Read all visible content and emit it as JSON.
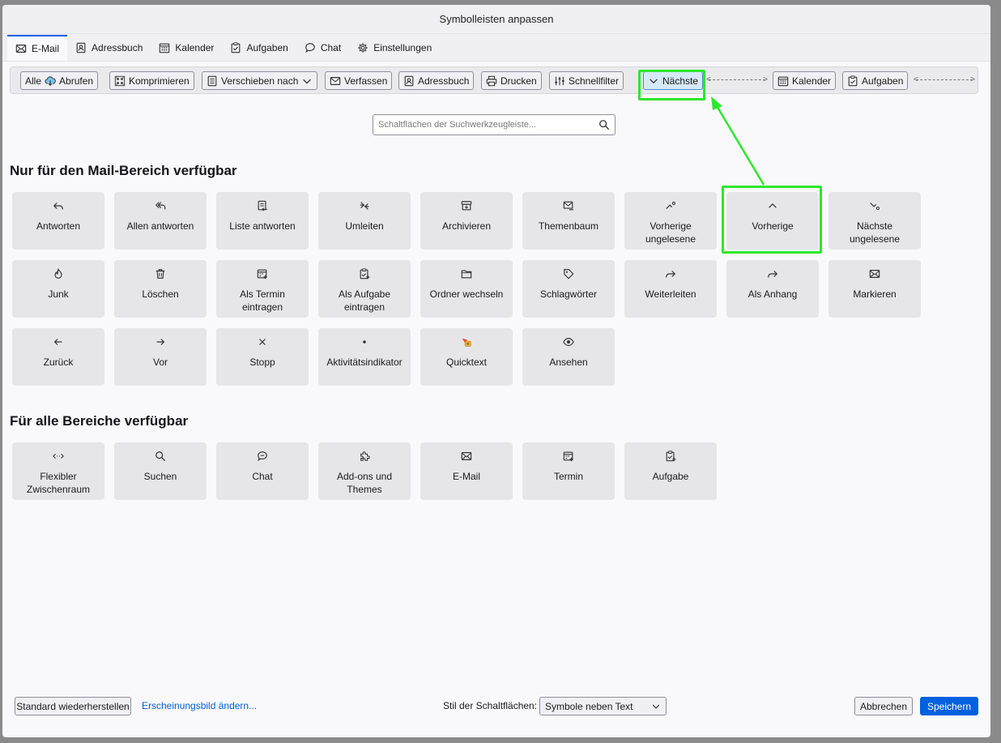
{
  "window": {
    "title": "Symbolleisten anpassen"
  },
  "tabs": [
    {
      "label": "E-Mail",
      "icon": "mail-icon",
      "active": true
    },
    {
      "label": "Adressbuch",
      "icon": "address-book-icon"
    },
    {
      "label": "Kalender",
      "icon": "calendar-icon"
    },
    {
      "label": "Aufgaben",
      "icon": "tasks-icon"
    },
    {
      "label": "Chat",
      "icon": "chat-icon"
    },
    {
      "label": "Einstellungen",
      "icon": "gear-icon"
    }
  ],
  "toolbar": {
    "items": [
      {
        "label": "Alle",
        "label2": "Abrufen",
        "icon": "download-cloud-icon"
      },
      {
        "label": "Komprimieren",
        "icon": "compress-icon"
      },
      {
        "label": "Verschieben nach",
        "icon": "move-icon"
      },
      {
        "label": "Verfassen",
        "icon": "compose-icon"
      },
      {
        "label": "Adressbuch",
        "icon": "address-book-icon"
      },
      {
        "label": "Drucken",
        "icon": "print-icon"
      },
      {
        "label": "Schnellfilter",
        "icon": "filter-icon"
      },
      {
        "label": "Nächste",
        "icon": "chevron-down-icon",
        "highlighted": true
      },
      {
        "label": "Kalender",
        "icon": "calendar-icon"
      },
      {
        "label": "Aufgaben",
        "icon": "tasks-icon"
      }
    ]
  },
  "search": {
    "placeholder": "Schaltflächen der Suchwerkzeugleiste..."
  },
  "mail_section": {
    "title": "Nur für den Mail-Bereich verfügbar",
    "items": [
      {
        "label": "Antworten",
        "icon": "reply-icon"
      },
      {
        "label": "Allen antworten",
        "icon": "reply-all-icon"
      },
      {
        "label": "Liste antworten",
        "icon": "reply-list-icon"
      },
      {
        "label": "Umleiten",
        "icon": "redirect-icon"
      },
      {
        "label": "Archivieren",
        "icon": "archive-icon"
      },
      {
        "label": "Themenbaum",
        "icon": "thread-icon"
      },
      {
        "label": "Vorherige ungelesene",
        "icon": "previous-unread-icon"
      },
      {
        "label": "Vorherige",
        "icon": "chevron-up-icon",
        "highlighted": true
      },
      {
        "label": "Nächste ungelesene",
        "icon": "next-unread-icon"
      },
      {
        "label": "Junk",
        "icon": "junk-icon"
      },
      {
        "label": "Löschen",
        "icon": "trash-icon"
      },
      {
        "label": "Als Termin eintragen",
        "icon": "add-event-icon"
      },
      {
        "label": "Als Aufgabe eintragen",
        "icon": "add-task-icon"
      },
      {
        "label": "Ordner wechseln",
        "icon": "folder-icon"
      },
      {
        "label": "Schlagwörter",
        "icon": "tag-icon"
      },
      {
        "label": "Weiterleiten",
        "icon": "forward-icon"
      },
      {
        "label": "Als Anhang",
        "icon": "forward-attachment-icon"
      },
      {
        "label": "Markieren",
        "icon": "mark-icon"
      },
      {
        "label": "Zurück",
        "icon": "arrow-left-icon"
      },
      {
        "label": "Vor",
        "icon": "arrow-right-icon"
      },
      {
        "label": "Stopp",
        "icon": "close-icon"
      },
      {
        "label": "Aktivitätsindikator",
        "icon": "dot-icon"
      },
      {
        "label": "Quicktext",
        "icon": "quicktext-icon"
      },
      {
        "label": "Ansehen",
        "icon": "eye-icon"
      }
    ]
  },
  "all_section": {
    "title": "Für alle Bereiche verfügbar",
    "items": [
      {
        "label": "Flexibler Zwischenraum",
        "icon": "flexible-space-icon"
      },
      {
        "label": "Suchen",
        "icon": "search-icon"
      },
      {
        "label": "Chat",
        "icon": "chat-icon"
      },
      {
        "label": "Add-ons und Themes",
        "icon": "puzzle-icon"
      },
      {
        "label": "E-Mail",
        "icon": "mail-icon"
      },
      {
        "label": "Termin",
        "icon": "calendar-event-icon"
      },
      {
        "label": "Aufgabe",
        "icon": "task-icon"
      }
    ]
  },
  "footer": {
    "restore_label": "Standard wiederherstellen",
    "appearance_link": "Erscheinungsbild ändern...",
    "style_label": "Stil der Schaltflächen:",
    "style_value": "Symbole neben Text",
    "cancel_label": "Abbrechen",
    "save_label": "Speichern"
  },
  "colors": {
    "accent": "#0061e0",
    "annotation": "#2ee62e",
    "highlight_bg": "#d5e9f7"
  }
}
